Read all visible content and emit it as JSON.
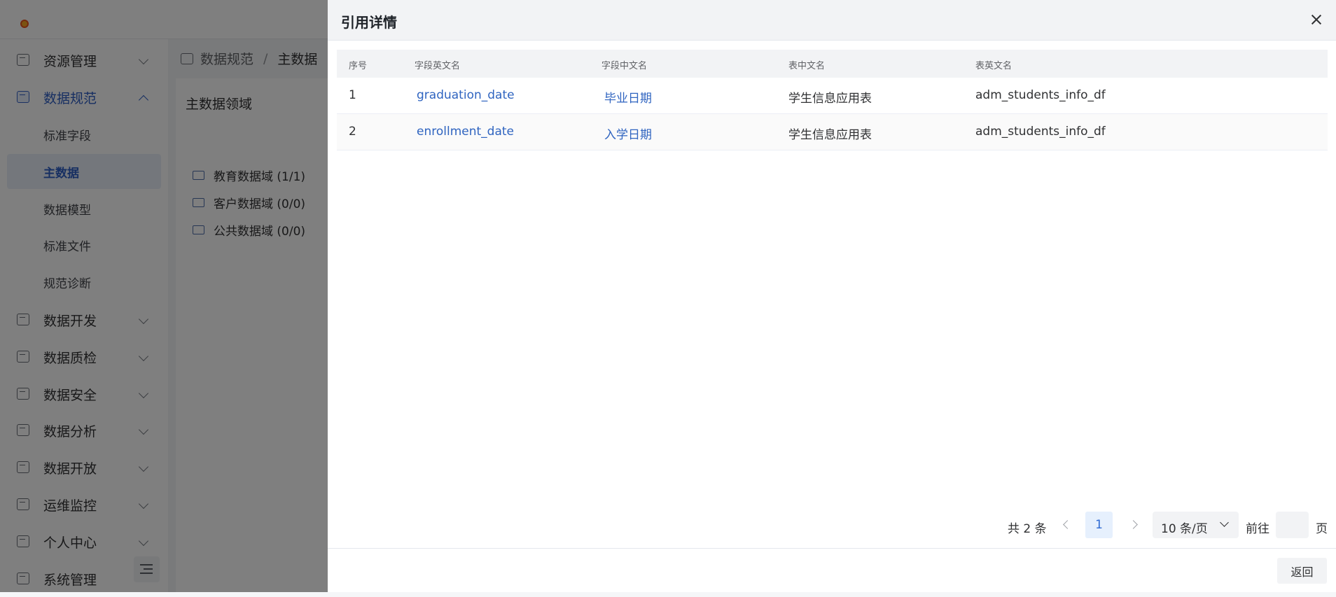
{
  "sidebar": {
    "items": [
      {
        "label": "资源管理"
      },
      {
        "label": "数据规范"
      },
      {
        "label": "数据开发"
      },
      {
        "label": "数据质检"
      },
      {
        "label": "数据安全"
      },
      {
        "label": "数据分析"
      },
      {
        "label": "数据开放"
      },
      {
        "label": "运维监控"
      },
      {
        "label": "个人中心"
      },
      {
        "label": "系统管理"
      }
    ],
    "sub_items": [
      {
        "label": "标准字段"
      },
      {
        "label": "主数据"
      },
      {
        "label": "数据模型"
      },
      {
        "label": "标准文件"
      },
      {
        "label": "规范诊断"
      }
    ]
  },
  "breadcrumb": {
    "parent": "数据规范",
    "separator": "/",
    "current": "主数据"
  },
  "panel": {
    "title": "主数据领域",
    "tree": [
      {
        "label": "教育数据域 (1/1)"
      },
      {
        "label": "客户数据域 (0/0)"
      },
      {
        "label": "公共数据域 (0/0)"
      }
    ]
  },
  "drawer": {
    "title": "引用详情",
    "columns": [
      "序号",
      "字段英文名",
      "字段中文名",
      "表中文名",
      "表英文名"
    ],
    "rows": [
      [
        "1",
        "graduation_date",
        "毕业日期",
        "学生信息应用表",
        "adm_students_info_df"
      ],
      [
        "2",
        "enrollment_date",
        "入学日期",
        "学生信息应用表",
        "adm_students_info_df"
      ]
    ],
    "pagination": {
      "total": "共 2 条",
      "current_page": "1",
      "page_size": "10 条/页",
      "goto_label": "前往",
      "goto_value": "",
      "page_suffix": "页"
    },
    "back_label": "返回"
  },
  "colors": {
    "accent": "#2f64c0",
    "overlay": "rgba(0,0,0,0.5)",
    "header_bg": "#f2f3f5"
  }
}
